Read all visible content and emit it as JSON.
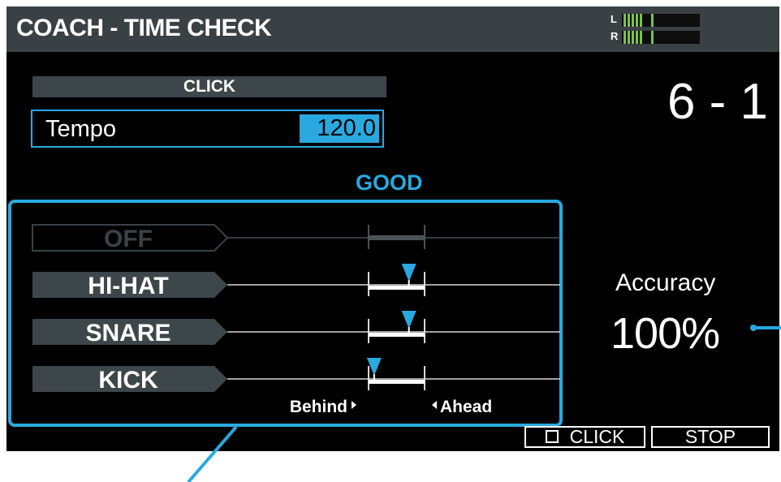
{
  "header": {
    "title": "COACH - TIME CHECK",
    "meter_left": "L",
    "meter_right": "R"
  },
  "click_section": {
    "label": "CLICK",
    "tempo_label": "Tempo",
    "tempo_value": "120.0"
  },
  "pattern_number": "6 - 1",
  "grade": "GOOD",
  "timing": {
    "rows": [
      {
        "label": "OFF",
        "enabled": false,
        "marker": null
      },
      {
        "label": "HI-HAT",
        "enabled": true,
        "marker": 0.72
      },
      {
        "label": "SNARE",
        "enabled": true,
        "marker": 0.72
      },
      {
        "label": "KICK",
        "enabled": true,
        "marker": 0.1
      }
    ],
    "behind_label": "Behind",
    "ahead_label": "Ahead"
  },
  "accuracy": {
    "label": "Accuracy",
    "value": "100%"
  },
  "footer": {
    "click_button": "CLICK",
    "stop_button": "STOP"
  },
  "colors": {
    "accent": "#29a9e0",
    "meter": "#7dc24b",
    "label_bg": "#3d464b"
  }
}
